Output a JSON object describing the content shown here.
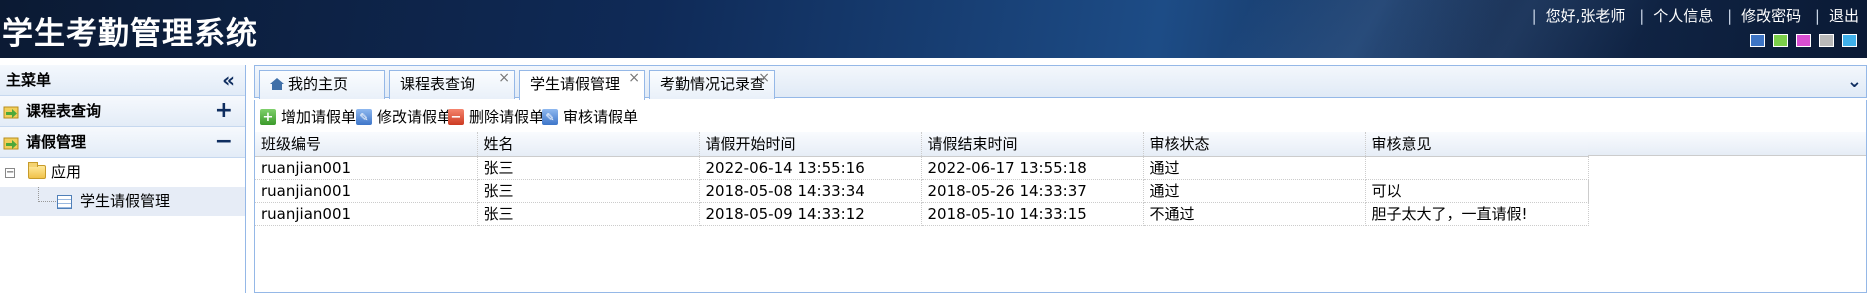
{
  "header": {
    "title": "学生考勤管理系统",
    "links": [
      "您好,张老师",
      "个人信息",
      "修改密码",
      "退出"
    ],
    "theme_colors": [
      "#3d74c4",
      "#7ccf4a",
      "#d94fd2",
      "#b9b9b9",
      "#3fb0ea"
    ]
  },
  "sidebar": {
    "title": "主菜单",
    "collapse_icon": "double-chevron-left-icon",
    "sections": [
      {
        "label": "课程表查询",
        "control": "+"
      },
      {
        "label": "请假管理",
        "control": "−"
      }
    ],
    "tree": {
      "folder": "应用",
      "items": [
        "学生请假管理"
      ]
    }
  },
  "tabs": [
    {
      "label": "我的主页",
      "closable": false
    },
    {
      "label": "课程表查询",
      "closable": true
    },
    {
      "label": "学生请假管理",
      "closable": true,
      "active": true
    },
    {
      "label": "考勤情况记录查",
      "closable": true
    }
  ],
  "toolbar": {
    "add": "增加请假单",
    "edit": "修改请假单",
    "delete": "删除请假单",
    "audit": "审核请假单"
  },
  "table": {
    "columns": [
      "班级编号",
      "姓名",
      "请假开始时间",
      "请假结束时间",
      "审核状态",
      "审核意见"
    ],
    "rows": [
      [
        "ruanjian001",
        "张三",
        "2022-06-14 13:55:16",
        "2022-06-17 13:55:18",
        "通过",
        ""
      ],
      [
        "ruanjian001",
        "张三",
        "2018-05-08 14:33:34",
        "2018-05-26 14:33:37",
        "通过",
        "可以"
      ],
      [
        "ruanjian001",
        "张三",
        "2018-05-09 14:33:12",
        "2018-05-10 14:33:15",
        "不通过",
        "胆子太大了，一直请假!"
      ]
    ]
  }
}
